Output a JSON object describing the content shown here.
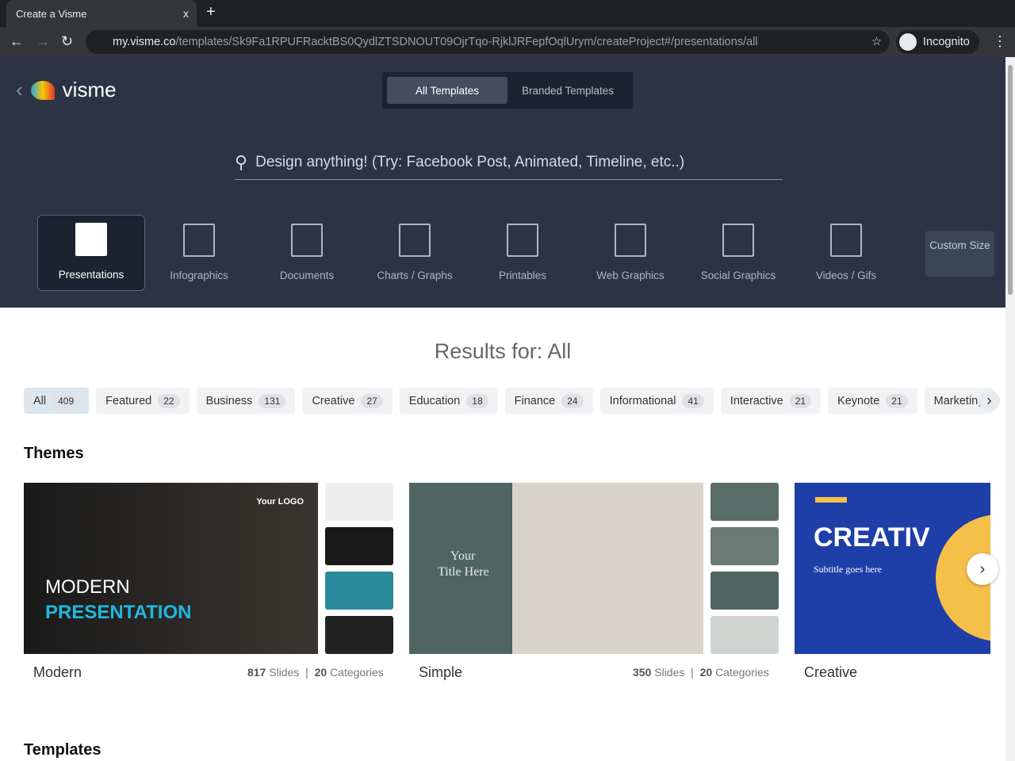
{
  "browser": {
    "tab_title": "Create a Visme",
    "close": "x",
    "new_tab": "+",
    "url_host": "my.visme.co",
    "url_path": "/templates/Sk9Fa1RPUFRacktBS0QydlZTSDNOUT09OjrTqo-RjklJRFepfOqlUrym/createProject#/presentations/all",
    "profile": "Incognito"
  },
  "header": {
    "logo": "visme",
    "segments": [
      "All Templates",
      "Branded Templates"
    ],
    "search_placeholder": "Design anything! (Try: Facebook Post, Animated, Timeline, etc..)"
  },
  "categories": [
    "Presentations",
    "Infographics",
    "Documents",
    "Charts / Graphs",
    "Printables",
    "Web Graphics",
    "Social Graphics",
    "Videos / Gifs"
  ],
  "custom_size": "Custom Size",
  "results_title": "Results for: All",
  "filters": [
    {
      "label": "All",
      "count": "409"
    },
    {
      "label": "Featured",
      "count": "22"
    },
    {
      "label": "Business",
      "count": "131"
    },
    {
      "label": "Creative",
      "count": "27"
    },
    {
      "label": "Education",
      "count": "18"
    },
    {
      "label": "Finance",
      "count": "24"
    },
    {
      "label": "Informational",
      "count": "41"
    },
    {
      "label": "Interactive",
      "count": "21"
    },
    {
      "label": "Keynote",
      "count": "21"
    },
    {
      "label": "Marketing",
      "count": ""
    }
  ],
  "themes_heading": "Themes",
  "themes": [
    {
      "name": "Modern",
      "slides": "817",
      "slides_label": "Slides",
      "cats": "20",
      "cats_label": "Categories",
      "thumb1": "MODERN",
      "thumb2": "PRESENTATION",
      "logo": "Your LOGO"
    },
    {
      "name": "Simple",
      "slides": "350",
      "slides_label": "Slides",
      "cats": "20",
      "cats_label": "Categories",
      "thumb1": "Your",
      "thumb2": "Title Here"
    },
    {
      "name": "Creative",
      "thumb1": "CREATIV",
      "thumb2": "Subtitle goes here"
    }
  ],
  "templates_heading": "Templates"
}
